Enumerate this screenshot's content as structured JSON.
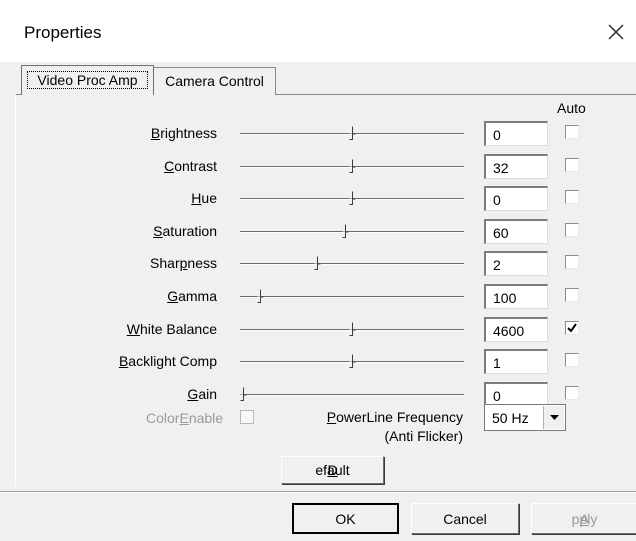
{
  "window": {
    "title": "Properties",
    "close_glyph": "✕"
  },
  "tabs": [
    {
      "label": "Video Proc Amp",
      "selected": true
    },
    {
      "label": "Camera Control",
      "selected": false
    }
  ],
  "auto_header": "Auto",
  "rows": [
    {
      "label_pre": "",
      "label_ul": "B",
      "label_post": "rightness",
      "value": "0",
      "slider_pos": 0.5,
      "auto": false
    },
    {
      "label_pre": "",
      "label_ul": "C",
      "label_post": "ontrast",
      "value": "32",
      "slider_pos": 0.5,
      "auto": false
    },
    {
      "label_pre": "",
      "label_ul": "H",
      "label_post": "ue",
      "value": "0",
      "slider_pos": 0.5,
      "auto": false
    },
    {
      "label_pre": "",
      "label_ul": "S",
      "label_post": "aturation",
      "value": "60",
      "slider_pos": 0.47,
      "auto": false
    },
    {
      "label_pre": "Shar",
      "label_ul": "p",
      "label_post": "ness",
      "value": "2",
      "slider_pos": 0.34,
      "auto": false
    },
    {
      "label_pre": "",
      "label_ul": "G",
      "label_post": "amma",
      "value": "100",
      "slider_pos": 0.08,
      "auto": false
    },
    {
      "label_pre": "",
      "label_ul": "W",
      "label_post": "hite Balance",
      "value": "4600",
      "slider_pos": 0.5,
      "auto": true
    },
    {
      "label_pre": "",
      "label_ul": "B",
      "label_post": "acklight Comp",
      "value": "1",
      "slider_pos": 0.5,
      "auto": false
    },
    {
      "label_pre": "",
      "label_ul": "G",
      "label_post": "ain",
      "value": "0",
      "slider_pos": 0.0,
      "auto": false
    }
  ],
  "color_enable": {
    "label_pre": "Color",
    "label_ul": "E",
    "label_post": "nable",
    "checked": false
  },
  "powerline": {
    "label_ul": "P",
    "label_post": "owerLine Frequency",
    "label_line2": "(Anti Flicker)",
    "selected": "50 Hz"
  },
  "buttons": {
    "default_ul": "D",
    "default_post": "efault",
    "ok": "OK",
    "cancel": "Cancel",
    "apply_ul": "A",
    "apply_post": "pply"
  }
}
